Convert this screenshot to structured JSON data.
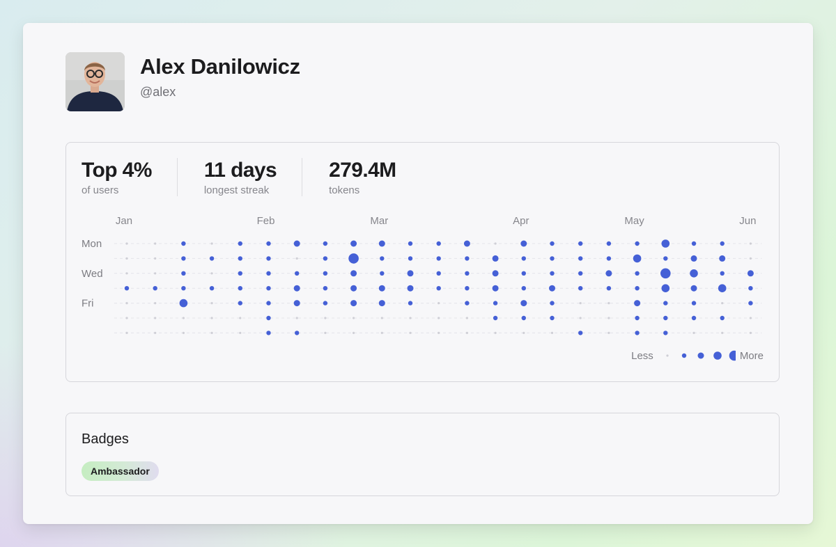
{
  "profile": {
    "name": "Alex Danilowicz",
    "handle": "@alex",
    "avatar_icon": "person-photo"
  },
  "stats": [
    {
      "value": "Top 4%",
      "label": "of users"
    },
    {
      "value": "11 days",
      "label": "longest streak"
    },
    {
      "value": "279.4M",
      "label": "tokens"
    }
  ],
  "chart_data": {
    "type": "heatmap",
    "encoding": "dot-size",
    "x_labels": [
      "Jan",
      "Feb",
      "Mar",
      "Apr",
      "May",
      "Jun"
    ],
    "x_label_columns": [
      0,
      5,
      9,
      14,
      18,
      22
    ],
    "y_labels": [
      "Mon",
      "",
      "Wed",
      "",
      "Fri",
      "",
      ""
    ],
    "columns": 23,
    "rows": 7,
    "levels": [
      0,
      1,
      2,
      3,
      4
    ],
    "values": [
      [
        0,
        0,
        1,
        0,
        1,
        1,
        2,
        1,
        2,
        2,
        1,
        1,
        2,
        0,
        2,
        1,
        1,
        1,
        1,
        3,
        1,
        1,
        0
      ],
      [
        0,
        0,
        1,
        1,
        1,
        1,
        0,
        1,
        4,
        1,
        1,
        1,
        1,
        2,
        1,
        1,
        1,
        1,
        3,
        1,
        2,
        2,
        0
      ],
      [
        0,
        0,
        1,
        0,
        1,
        1,
        1,
        1,
        2,
        1,
        2,
        1,
        1,
        2,
        1,
        1,
        1,
        2,
        1,
        4,
        3,
        1,
        2
      ],
      [
        1,
        1,
        1,
        1,
        1,
        1,
        2,
        1,
        2,
        2,
        2,
        1,
        1,
        2,
        1,
        2,
        1,
        1,
        1,
        3,
        2,
        3,
        1
      ],
      [
        0,
        0,
        3,
        0,
        1,
        1,
        2,
        1,
        2,
        2,
        1,
        0,
        1,
        1,
        2,
        1,
        0,
        0,
        2,
        1,
        1,
        0,
        1
      ],
      [
        0,
        0,
        0,
        0,
        0,
        1,
        0,
        0,
        0,
        0,
        0,
        0,
        0,
        1,
        1,
        1,
        0,
        0,
        1,
        1,
        1,
        1,
        0
      ],
      [
        0,
        0,
        0,
        0,
        0,
        1,
        1,
        0,
        0,
        0,
        0,
        0,
        0,
        0,
        0,
        0,
        1,
        0,
        1,
        1,
        0,
        0,
        0
      ]
    ]
  },
  "legend": {
    "less_label": "Less",
    "more_label": "More"
  },
  "badges": {
    "title": "Badges",
    "items": [
      {
        "label": "Ambassador"
      }
    ]
  },
  "colors": {
    "dot": "#4560d6",
    "empty_dot": "#cfcfd6",
    "grid_line": "#e4e4e9",
    "accent": "#4560d6"
  }
}
